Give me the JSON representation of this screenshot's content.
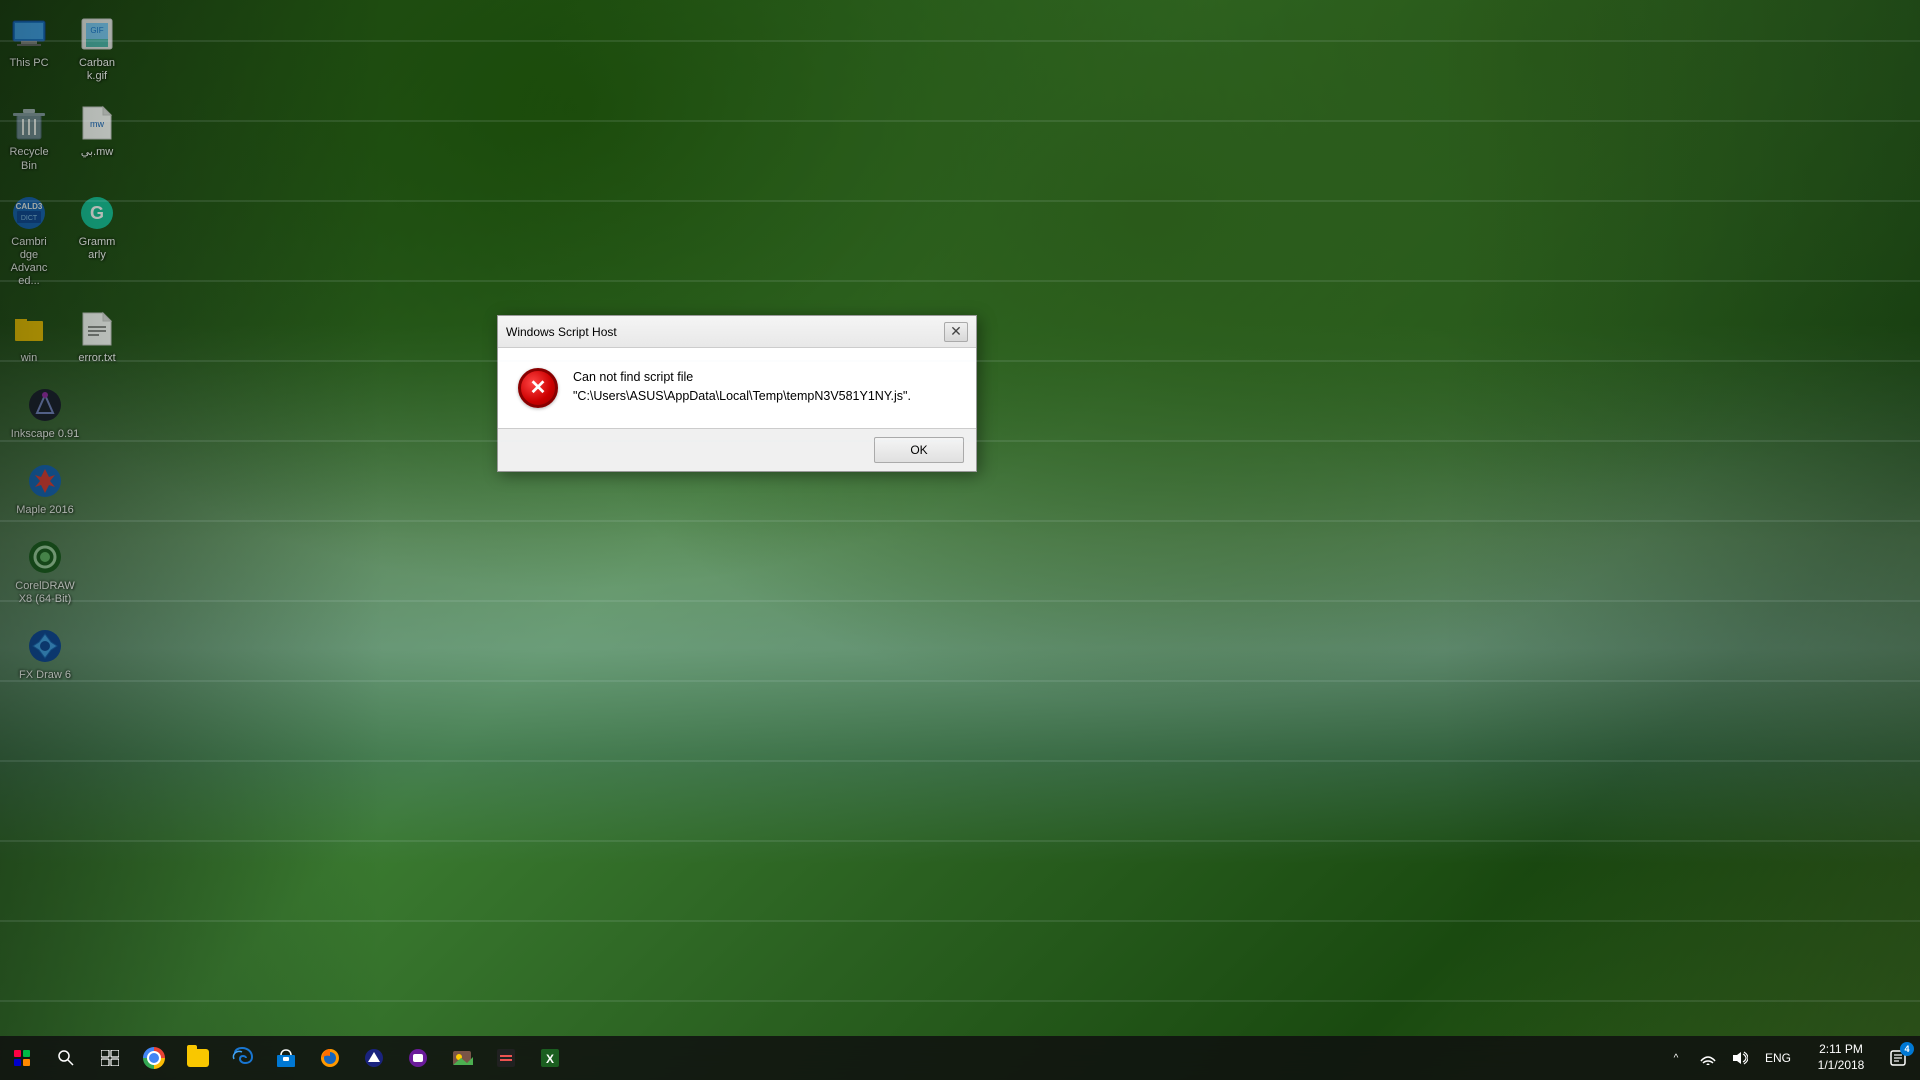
{
  "desktop": {
    "background_desc": "Windows 10 waterfall forest desktop"
  },
  "icons": [
    {
      "id": "this-pc",
      "label": "This PC",
      "emoji": "💻",
      "row": 1
    },
    {
      "id": "carbank",
      "label": "Carbank.gif",
      "emoji": "🖼",
      "row": 1
    },
    {
      "id": "recycle-bin",
      "label": "Recycle Bin",
      "emoji": "🗑",
      "row": 2
    },
    {
      "id": "mw-file",
      "label": "بي.mw",
      "emoji": "📄",
      "row": 2
    },
    {
      "id": "cambridge",
      "label": "Cambridge Advanced...",
      "emoji": "📘",
      "row": 3
    },
    {
      "id": "grammarly",
      "label": "Grammarly",
      "emoji": "✅",
      "row": 3
    },
    {
      "id": "win-file",
      "label": "win",
      "emoji": "📂",
      "row": 4
    },
    {
      "id": "error-txt",
      "label": "error.txt",
      "emoji": "📝",
      "row": 4
    },
    {
      "id": "inkscape",
      "label": "Inkscape 0.91",
      "emoji": "🖊",
      "row": 5
    },
    {
      "id": "maple",
      "label": "Maple 2016",
      "emoji": "🍁",
      "row": 6
    },
    {
      "id": "coreldraw",
      "label": "CorelDRAW X8 (64-Bit)",
      "emoji": "🎨",
      "row": 7
    },
    {
      "id": "fxdraw",
      "label": "FX Draw 6",
      "emoji": "💠",
      "row": 8
    }
  ],
  "dialog": {
    "title": "Windows Script Host",
    "close_label": "✕",
    "message_line1": "Can not find script file",
    "message_line2": "\"C:\\Users\\ASUS\\AppData\\Local\\Temp\\tempN3V581Y1NY.js\".",
    "ok_label": "OK"
  },
  "taskbar": {
    "start_icon": "⊞",
    "search_tooltip": "Search",
    "task_view_tooltip": "Task View",
    "pinned_apps": [
      {
        "id": "chrome",
        "label": "Google Chrome"
      },
      {
        "id": "explorer",
        "label": "File Explorer"
      },
      {
        "id": "edge",
        "label": "Microsoft Edge"
      },
      {
        "id": "store",
        "label": "Microsoft Store"
      },
      {
        "id": "firefox",
        "label": "Firefox"
      },
      {
        "id": "app1",
        "label": "App"
      },
      {
        "id": "app2",
        "label": "App"
      },
      {
        "id": "photos",
        "label": "Photos"
      },
      {
        "id": "app3",
        "label": "App"
      },
      {
        "id": "excel",
        "label": "Excel"
      }
    ],
    "tray": {
      "expand_label": "^",
      "network_icon": "📶",
      "volume_icon": "🔊",
      "lang_label": "ENG",
      "time": "2:11 PM",
      "date": "1/1/2018",
      "notify_label": "💬",
      "notify_count": "4"
    }
  }
}
